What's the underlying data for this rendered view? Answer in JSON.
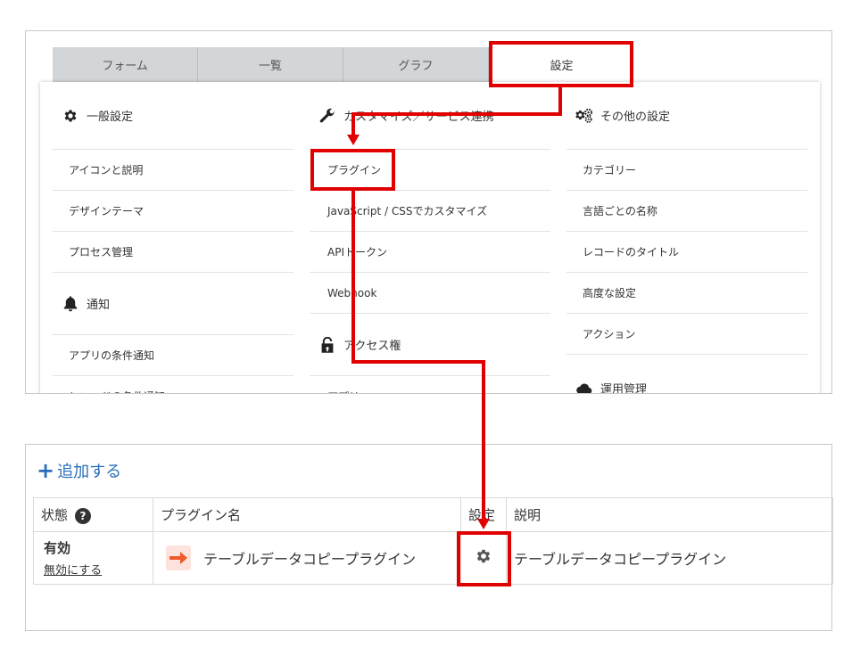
{
  "tabs": [
    {
      "label": "フォーム"
    },
    {
      "label": "一覧"
    },
    {
      "label": "グラフ"
    },
    {
      "label": "設定"
    }
  ],
  "general": {
    "title": "一般設定",
    "icon": "gear-icon",
    "items": [
      "アイコンと説明",
      "デザインテーマ",
      "プロセス管理"
    ]
  },
  "notify": {
    "title": "通知",
    "icon": "bell-icon",
    "items": [
      "アプリの条件通知",
      "レコードの条件通知"
    ]
  },
  "customize": {
    "title": "カスタマイズ／サービス連携",
    "icon": "wrench-icon",
    "items": [
      "プラグイン",
      "JavaScript / CSSでカスタマイズ",
      "APIトークン",
      "Webhook"
    ]
  },
  "access": {
    "title": "アクセス権",
    "icon": "lock-icon",
    "items": [
      "アプリ"
    ]
  },
  "other": {
    "title": "その他の設定",
    "icon": "gears-icon",
    "items": [
      "カテゴリー",
      "言語ごとの名称",
      "レコードのタイトル",
      "高度な設定",
      "アクション"
    ]
  },
  "ops": {
    "title": "運用管理",
    "icon": "cloud-icon"
  },
  "plugins": {
    "add_label": "追加する",
    "headers": {
      "state": "状態",
      "name": "プラグイン名",
      "settings": "設定",
      "desc": "説明"
    },
    "rows": [
      {
        "state": "有効",
        "state_action": "無効にする",
        "name": "テーブルデータコピープラグイン",
        "desc": "テーブルデータコピープラグイン"
      }
    ]
  },
  "colors": {
    "highlight": "#e00000",
    "link": "#2a6ebb",
    "plugin_accent": "#f05a28"
  }
}
